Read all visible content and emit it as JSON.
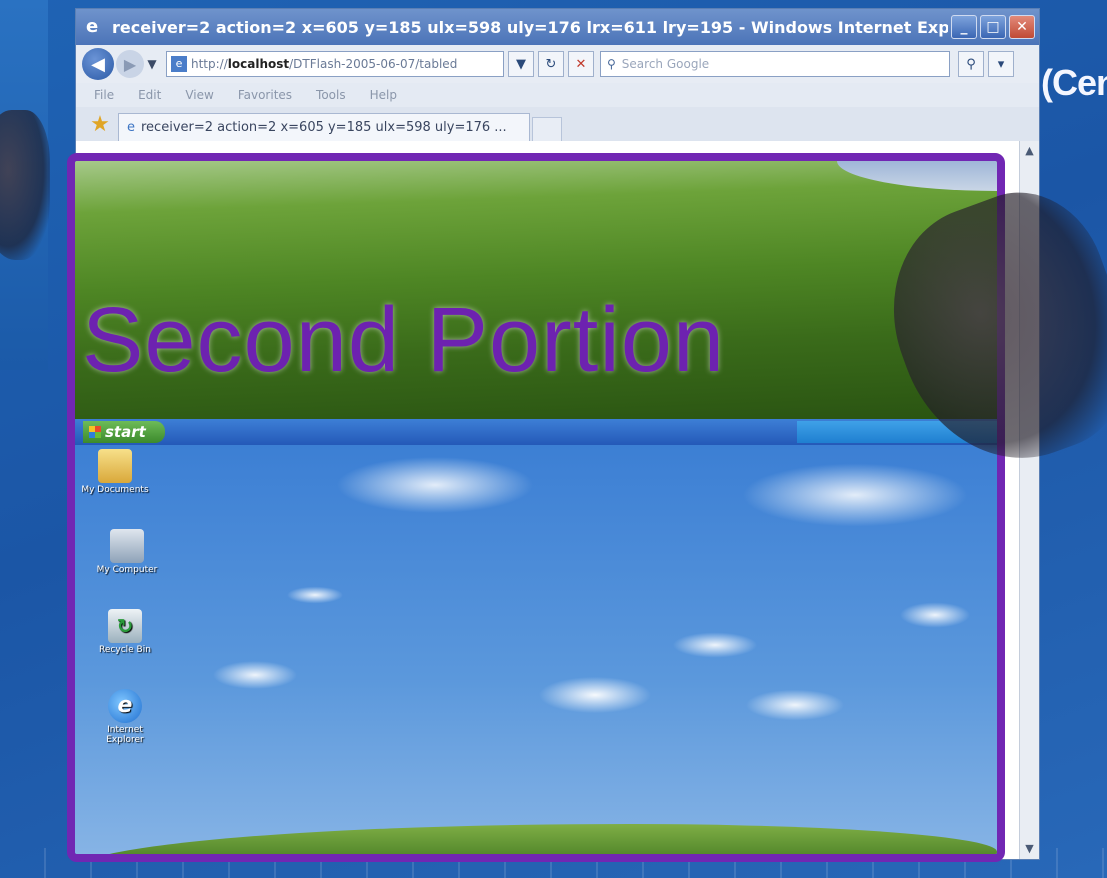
{
  "window": {
    "title": "receiver=2 action=2 x=605 y=185 ulx=598 uly=176 lrx=611 lry=195 - Windows Internet Explorer",
    "minimize_glyph": "_",
    "maximize_glyph": "□",
    "close_glyph": "✕"
  },
  "navbar": {
    "address_prefix": "http://",
    "address_host": "localhost",
    "address_path": "/DTFlash-2005-06-07/tabled",
    "search_placeholder": "Search Google"
  },
  "menu": {
    "items": [
      "File",
      "Edit",
      "View",
      "Favorites",
      "Tools",
      "Help"
    ]
  },
  "tab": {
    "label": "receiver=2 action=2 x=605 y=185 ulx=598 uly=176 ..."
  },
  "backdrop": {
    "logo_text": "(Cent"
  },
  "desktop": {
    "start_label": "start",
    "icons": [
      {
        "label": "My Documents"
      },
      {
        "label": "My Computer"
      },
      {
        "label": "Recycle Bin"
      },
      {
        "label": "Internet Explorer"
      }
    ]
  },
  "overlay": {
    "label": "Second Portion",
    "frame_color": "#7127b3"
  },
  "colors": {
    "accent": "#7127b3",
    "titlebar": "#4c74b8",
    "taskbar": "#2459b8",
    "start_button": "#3c8a2c"
  }
}
